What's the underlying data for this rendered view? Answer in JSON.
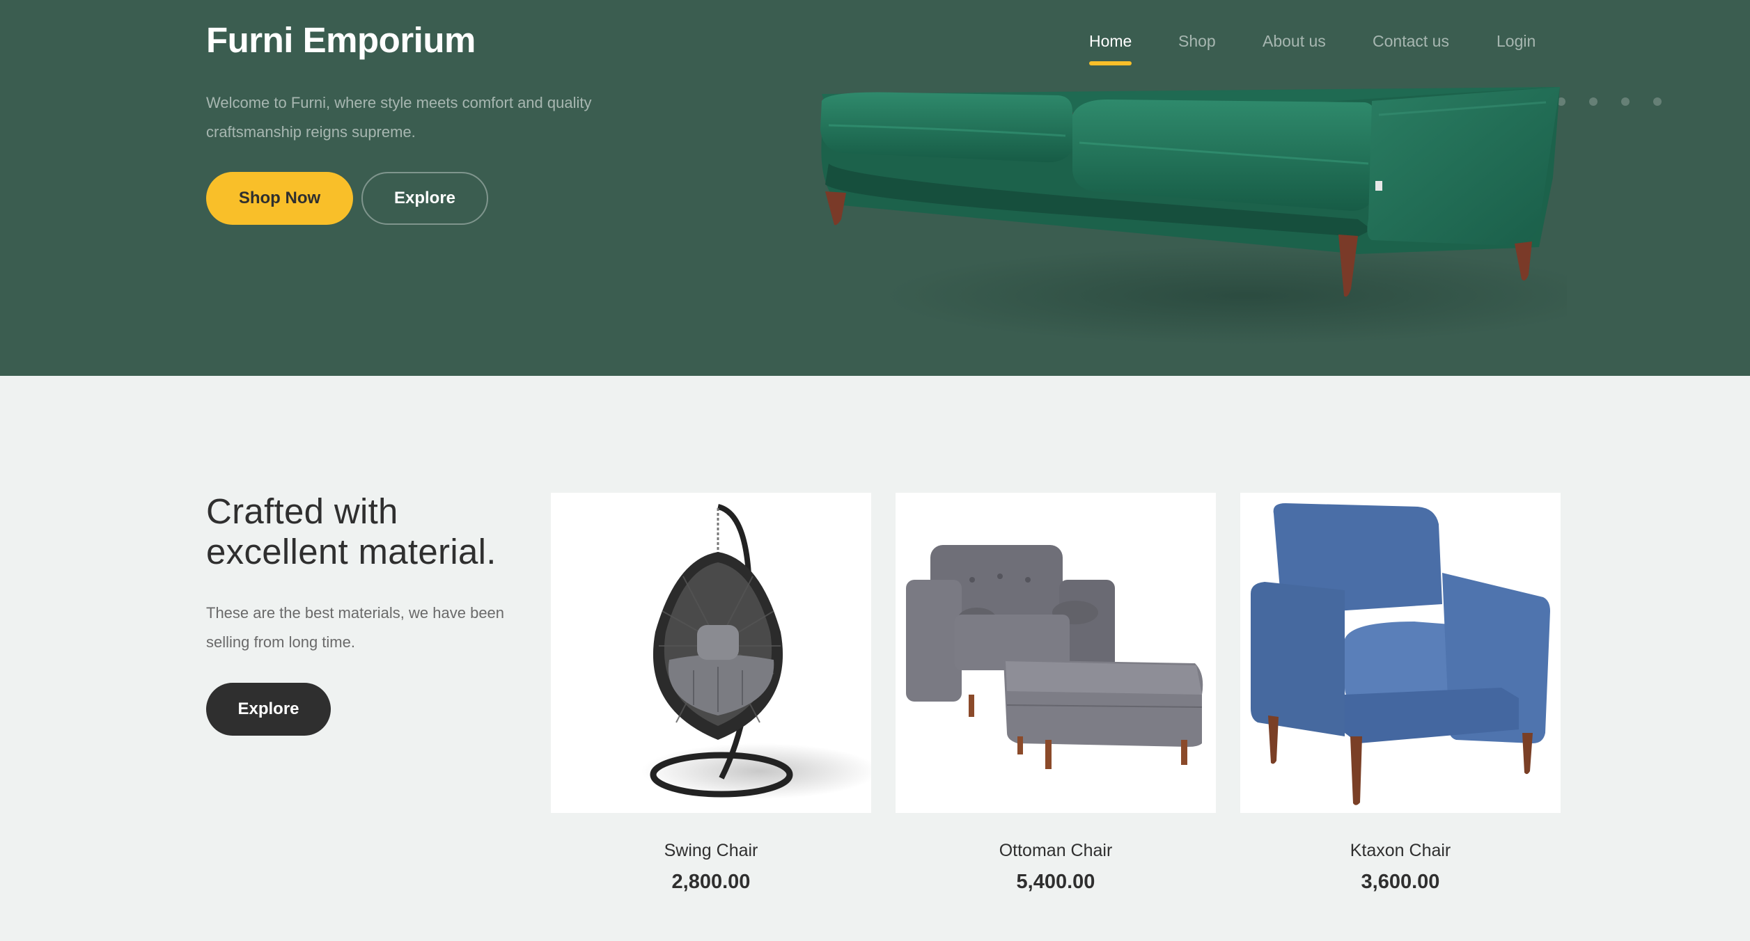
{
  "brand": {
    "name": "Furni Emporium"
  },
  "nav": {
    "items": [
      {
        "label": "Home",
        "active": true
      },
      {
        "label": "Shop"
      },
      {
        "label": "About us"
      },
      {
        "label": "Contact us"
      },
      {
        "label": "Login"
      }
    ]
  },
  "hero": {
    "tagline": "Welcome to Furni, where style meets comfort and quality craftsmanship reigns supreme.",
    "shop_now_label": "Shop Now",
    "explore_label": "Explore",
    "image": "green-velvet-sofa"
  },
  "material": {
    "heading_line1": "Crafted with",
    "heading_line2": "excellent material.",
    "description": "These are the best materials, we have been selling from long time.",
    "explore_label": "Explore"
  },
  "products": [
    {
      "name": "Swing Chair",
      "price": "2,800.00",
      "image": "hanging-egg-swing-chair"
    },
    {
      "name": "Ottoman Chair",
      "price": "5,400.00",
      "image": "grey-armchair-with-ottoman"
    },
    {
      "name": "Ktaxon Chair",
      "price": "3,600.00",
      "image": "blue-armchair"
    }
  ],
  "colors": {
    "hero_bg": "#3b5d50",
    "accent": "#f9bf29",
    "page_bg": "#eff2f1",
    "dark": "#2f2f2f"
  }
}
